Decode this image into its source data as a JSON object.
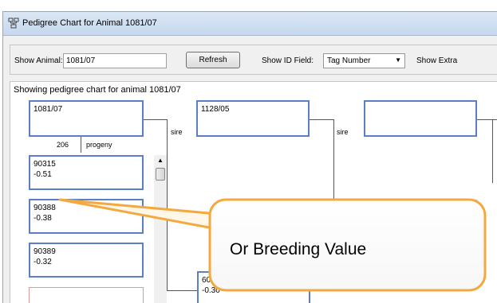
{
  "window": {
    "title": "Pedigree Chart for Animal 1081/07"
  },
  "toolbar": {
    "show_animal_label": "Show Animal:",
    "show_animal_value": "1081/07",
    "refresh_label": "Refresh",
    "show_id_field_label": "Show ID Field:",
    "show_id_field_value": "Tag Number",
    "show_extra_label": "Show Extra"
  },
  "chart": {
    "heading": "Showing pedigree chart for animal 1081/07",
    "root_animal": "1081/07",
    "sire_1": "1128/05",
    "sire_label": "sire",
    "progeny_count": "206",
    "progeny_label": "progeny",
    "progeny": [
      {
        "id": "90315",
        "value": "-0.51"
      },
      {
        "id": "90388",
        "value": "-0.38"
      },
      {
        "id": "90389",
        "value": "-0.32"
      }
    ],
    "partial_box_label": "60",
    "partial_box_value": "-0.30"
  },
  "callout": {
    "text": "Or Breeding Value"
  },
  "colors": {
    "node_border": "#5b7fc7",
    "callout_border": "#f4a940",
    "arrow": "#f4a940"
  },
  "icons": {
    "title_icon": "pedigree-tree-icon",
    "dropdown": "chevron-down-icon",
    "scroll_up": "scroll-up-arrow-icon"
  }
}
